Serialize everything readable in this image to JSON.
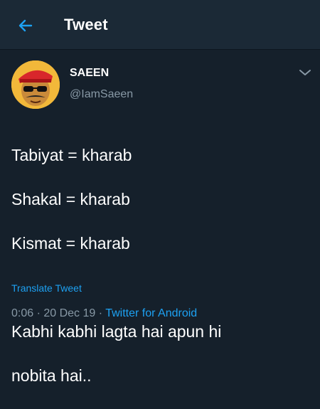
{
  "header": {
    "title": "Tweet",
    "back_icon": "arrow-left-icon"
  },
  "author": {
    "display_name": "SAEEN",
    "handle": "@IamSaeen",
    "avatar_icon": "cartoon-avatar"
  },
  "tweet": {
    "lines": [
      "Tabiyat = kharab",
      "Shakal = kharab",
      "Kismat = kharab",
      "",
      "Kabhi kabhi lagta hai apun hi",
      "nobita hai.."
    ]
  },
  "translate_label": "Translate Tweet",
  "meta": {
    "time": "0:06",
    "separator": " · ",
    "date": "20 Dec 19",
    "source": "Twitter for Android"
  },
  "colors": {
    "background": "#15202b",
    "header": "#1b2936",
    "accent": "#1da1f2",
    "secondary_text": "#8899a6"
  }
}
